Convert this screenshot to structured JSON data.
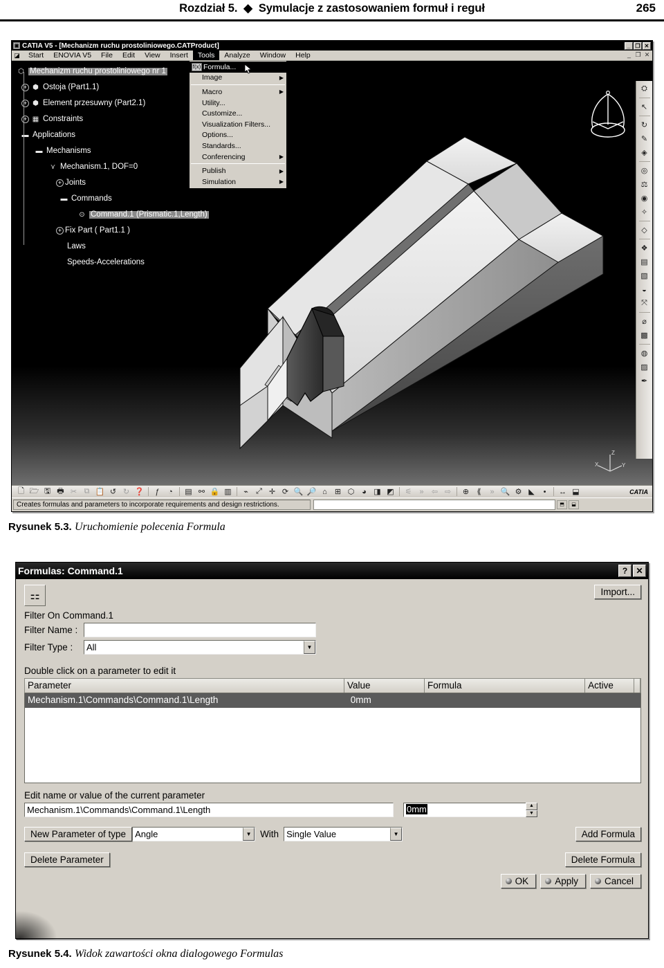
{
  "page": {
    "header_title": "Rozdział 5.  ◆  Symulacje z zastosowaniem formuł i reguł",
    "page_number": "265"
  },
  "captions": {
    "fig53_number": "Rysunek 5.3.",
    "fig53_text": "Uruchomienie polecenia Formula",
    "fig54_number": "Rysunek 5.4.",
    "fig54_text": "Widok zawartości okna dialogowego Formulas"
  },
  "catia": {
    "title": "CATIA V5 - [Mechanizm ruchu prostoliniowego.CATProduct]",
    "title_icon": "catia-app-icon",
    "window_buttons": [
      "minimize",
      "restore",
      "close"
    ],
    "mdi_buttons": [
      "minimize",
      "restore",
      "close"
    ],
    "menu": [
      {
        "label": "Start",
        "active": false
      },
      {
        "label": "ENOVIA V5",
        "active": false
      },
      {
        "label": "File",
        "active": false
      },
      {
        "label": "Edit",
        "active": false
      },
      {
        "label": "View",
        "active": false
      },
      {
        "label": "Insert",
        "active": false
      },
      {
        "label": "Tools",
        "active": true
      },
      {
        "label": "Analyze",
        "active": false
      },
      {
        "label": "Window",
        "active": false
      },
      {
        "label": "Help",
        "active": false
      }
    ],
    "tools_menu": [
      {
        "label": "Formula...",
        "icon": "fx-icon",
        "submenu": false,
        "highlight": true
      },
      {
        "label": "Image",
        "icon": "",
        "submenu": true,
        "highlight": false
      },
      {
        "separator": true
      },
      {
        "label": "Macro",
        "icon": "",
        "submenu": true,
        "highlight": false
      },
      {
        "label": "Utility...",
        "icon": "",
        "submenu": false,
        "highlight": false
      },
      {
        "label": "Customize...",
        "icon": "",
        "submenu": false,
        "highlight": false
      },
      {
        "label": "Visualization Filters...",
        "icon": "",
        "submenu": false,
        "highlight": false
      },
      {
        "label": "Options...",
        "icon": "",
        "submenu": false,
        "highlight": false
      },
      {
        "label": "Standards...",
        "icon": "",
        "submenu": false,
        "highlight": false
      },
      {
        "label": "Conferencing",
        "icon": "",
        "submenu": true,
        "highlight": false
      },
      {
        "separator": true
      },
      {
        "label": "Publish",
        "icon": "",
        "submenu": true,
        "highlight": false
      },
      {
        "label": "Simulation",
        "icon": "",
        "submenu": true,
        "highlight": false
      }
    ],
    "spec_tree": [
      {
        "label": "Mechanizm ruchu prostoliniowego nr 1",
        "indent": 0,
        "icon": "product-icon",
        "expander": "",
        "selected": true
      },
      {
        "label": "Ostoja (Part1.1)",
        "indent": 1,
        "icon": "part-icon",
        "expander": "+",
        "selected": false
      },
      {
        "label": "Element przesuwny (Part2.1)",
        "indent": 1,
        "icon": "part-icon",
        "expander": "+",
        "selected": false
      },
      {
        "label": "Constraints",
        "indent": 1,
        "icon": "constraints-icon",
        "expander": "+",
        "selected": false
      },
      {
        "label": "Applications",
        "indent": 1,
        "icon": "applications-icon",
        "expander": "-",
        "selected": false
      },
      {
        "label": "Mechanisms",
        "indent": 2,
        "icon": "mechanisms-icon",
        "expander": "-",
        "selected": false
      },
      {
        "label": "Mechanism.1, DOF=0",
        "indent": 3,
        "icon": "mechanism-icon",
        "expander": "-",
        "selected": false
      },
      {
        "label": "Joints",
        "indent": 4,
        "icon": "",
        "expander": "+",
        "selected": false
      },
      {
        "label": "Commands",
        "indent": 4,
        "icon": "",
        "expander": "-",
        "selected": false
      },
      {
        "label": "Command.1 (Prismatic.1,Length)",
        "indent": 5,
        "icon": "command-icon",
        "expander": "",
        "selected": true
      },
      {
        "label": "Fix Part ( Part1.1 )",
        "indent": 4,
        "icon": "",
        "expander": "+",
        "selected": false
      },
      {
        "label": "Laws",
        "indent": 4,
        "icon": "",
        "expander": "",
        "selected": false
      },
      {
        "label": "Speeds-Accelerations",
        "indent": 4,
        "icon": "",
        "expander": "",
        "selected": false
      }
    ],
    "status_text": "Creates formulas and parameters to incorporate requirements and design restrictions.",
    "status_input_value": "",
    "viewport": {
      "compass_icon": "3d-compass-icon",
      "axis_labels": [
        "X",
        "Y",
        "Z"
      ],
      "model_name": "linear-guide-assembly"
    },
    "right_toolbar_icons": [
      "fit-all-icon",
      "select-arrow-icon",
      "update-icon",
      "sketcher-icon",
      "pad-icon",
      "pocket-icon",
      "shaft-icon",
      "hole-icon",
      "fillet-icon",
      "chamfer-icon",
      "pattern-icon",
      "draft-icon",
      "shell-icon",
      "boolean-icon",
      "transform-icon",
      "measure-icon",
      "analysis-icon",
      "apply-material-icon"
    ],
    "bottom_toolbar_icons": [
      "new-icon",
      "open-icon",
      "save-icon",
      "print-icon",
      "cut-icon",
      "copy-icon",
      "paste-icon",
      "undo-icon",
      "redo-icon",
      "whats-this-icon",
      "formula-fx-icon",
      "knowledge-icon",
      "table-icon",
      "graph-icon",
      "lock-icon",
      "tree-icon",
      "fly-mode-icon",
      "fit-all-icon",
      "pan-icon",
      "rotate-icon",
      "zoom-in-icon",
      "zoom-out-icon",
      "normal-view-icon",
      "multi-view-icon",
      "iso-view-icon",
      "render-style-icon",
      "hide-show-icon",
      "swap-visible-icon",
      "section-icon",
      "cut-plane-icon",
      "annotation-icon",
      "link-icon",
      "center-graph-icon",
      "reframe-icon",
      "tree-collapse-icon",
      "search-icon",
      "power-input-icon",
      "highlight-icon",
      "point-icon",
      "distance-icon",
      "inertia-icon"
    ],
    "logo_text": "CATIA"
  },
  "formulas_dialog": {
    "title": "Formulas: Command.1",
    "help_button": "?",
    "close_button": "✕",
    "filter_tree_icon": "parameter-tree-icon",
    "import_label": "Import...",
    "filter_on_label": "Filter On Command.1",
    "filter_name_label": "Filter Name :",
    "filter_name_value": "",
    "filter_type_label": "Filter Type :",
    "filter_type_value": "All",
    "hint_label": "Double click on a parameter to edit it",
    "table": {
      "columns": [
        "Parameter",
        "Value",
        "Formula",
        "Active"
      ],
      "rows": [
        {
          "parameter": "Mechanism.1\\Commands\\Command.1\\Length",
          "value": "0mm",
          "formula": "",
          "active": "",
          "selected": true
        }
      ]
    },
    "edit_label": "Edit name or value of the current parameter",
    "edit_name_value": "Mechanism.1\\Commands\\Command.1\\Length",
    "edit_value_value": "0mm",
    "new_param_label": "New Parameter of type",
    "new_param_type": "Angle",
    "with_label": "With",
    "with_value": "Single Value",
    "add_formula_label": "Add Formula",
    "delete_parameter_label": "Delete Parameter",
    "delete_formula_label": "Delete Formula",
    "ok_label": "OK",
    "apply_label": "Apply",
    "cancel_label": "Cancel"
  }
}
